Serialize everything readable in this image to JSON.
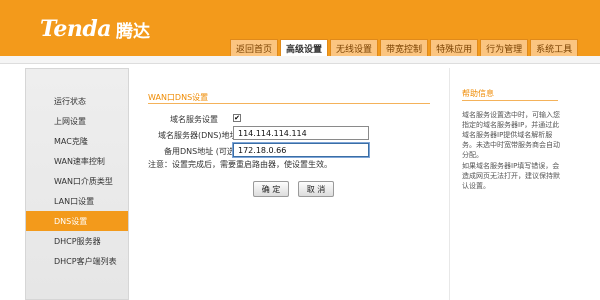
{
  "brand": {
    "logo_en": "Tenda",
    "logo_cn": "腾达"
  },
  "colors": {
    "accent": "#f39a1b",
    "tab_bg": "#fbc581",
    "sidebar_active": "#f39a1b",
    "title": "#ef8a00"
  },
  "nav": {
    "tabs": [
      {
        "label": "返回首页"
      },
      {
        "label": "高级设置",
        "active": true
      },
      {
        "label": "无线设置"
      },
      {
        "label": "带宽控制"
      },
      {
        "label": "特殊应用"
      },
      {
        "label": "行为管理"
      },
      {
        "label": "系统工具"
      }
    ]
  },
  "sidebar": {
    "items": [
      {
        "label": "运行状态"
      },
      {
        "label": "上网设置"
      },
      {
        "label": "MAC克隆"
      },
      {
        "label": "WAN速率控制"
      },
      {
        "label": "WAN口介质类型"
      },
      {
        "label": "LAN口设置"
      },
      {
        "label": "DNS设置",
        "active": true
      },
      {
        "label": "DHCP服务器"
      },
      {
        "label": "DHCP客户端列表"
      }
    ]
  },
  "main": {
    "section_title": "WAN口DNS设置",
    "dns_service_label": "域名服务设置",
    "dns_service_checked": true,
    "checkbox_mark": "✔",
    "primary_dns_label": "域名服务器(DNS)地址",
    "primary_dns_value": "114.114.114.114",
    "secondary_dns_label": "备用DNS地址 (可选)",
    "secondary_dns_value": "172.18.0.66",
    "note": "注意：设置完成后，需要重启路由器，使设置生效。",
    "ok_label": "确 定",
    "cancel_label": "取 消"
  },
  "help": {
    "title": "帮助信息",
    "paragraphs": [
      "域名服务设置选中时，可输入您指定的域名服务器IP，并通过此域名服务器IP提供域名解析服务。未选中时宽带服务商会自动分配。",
      "如果域名服务器IP填写错误，会造成网页无法打开，建议保持默认设置。"
    ]
  }
}
